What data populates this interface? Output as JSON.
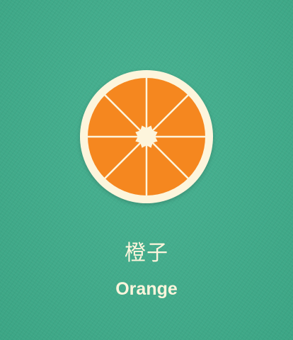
{
  "card": {
    "background_color": "#3fae8c",
    "icon": {
      "name": "orange-slice-icon",
      "rind_color": "#fdf5dc",
      "flesh_color": "#f5871f",
      "segments": 8
    },
    "title_chinese": "橙子",
    "title_english": "Orange",
    "text_color": "#fdf5dc"
  }
}
